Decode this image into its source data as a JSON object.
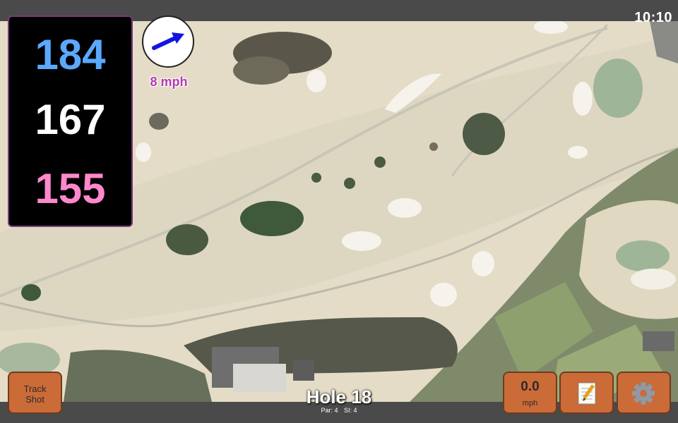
{
  "status": {
    "time": "10:10"
  },
  "distances": {
    "back": "184",
    "middle": "167",
    "front": "155"
  },
  "wind": {
    "speed_label": "8 mph",
    "direction_icon": "arrow-up-right-icon"
  },
  "hole": {
    "title": "Hole 18",
    "par_label": "Par: 4",
    "si_label": "SI: 4"
  },
  "buttons": {
    "track_shot_line1": "Track",
    "track_shot_line2": "Shot",
    "speed_value": "0.0",
    "speed_unit": "mph",
    "notes_icon": "notepad-icon",
    "settings_icon": "gear-icon"
  },
  "colors": {
    "back_distance": "#5aa9ff",
    "middle_distance": "#ffffff",
    "front_distance": "#ff88cc",
    "button_bg": "#cb6b38",
    "wind_text": "#b23ab2"
  }
}
